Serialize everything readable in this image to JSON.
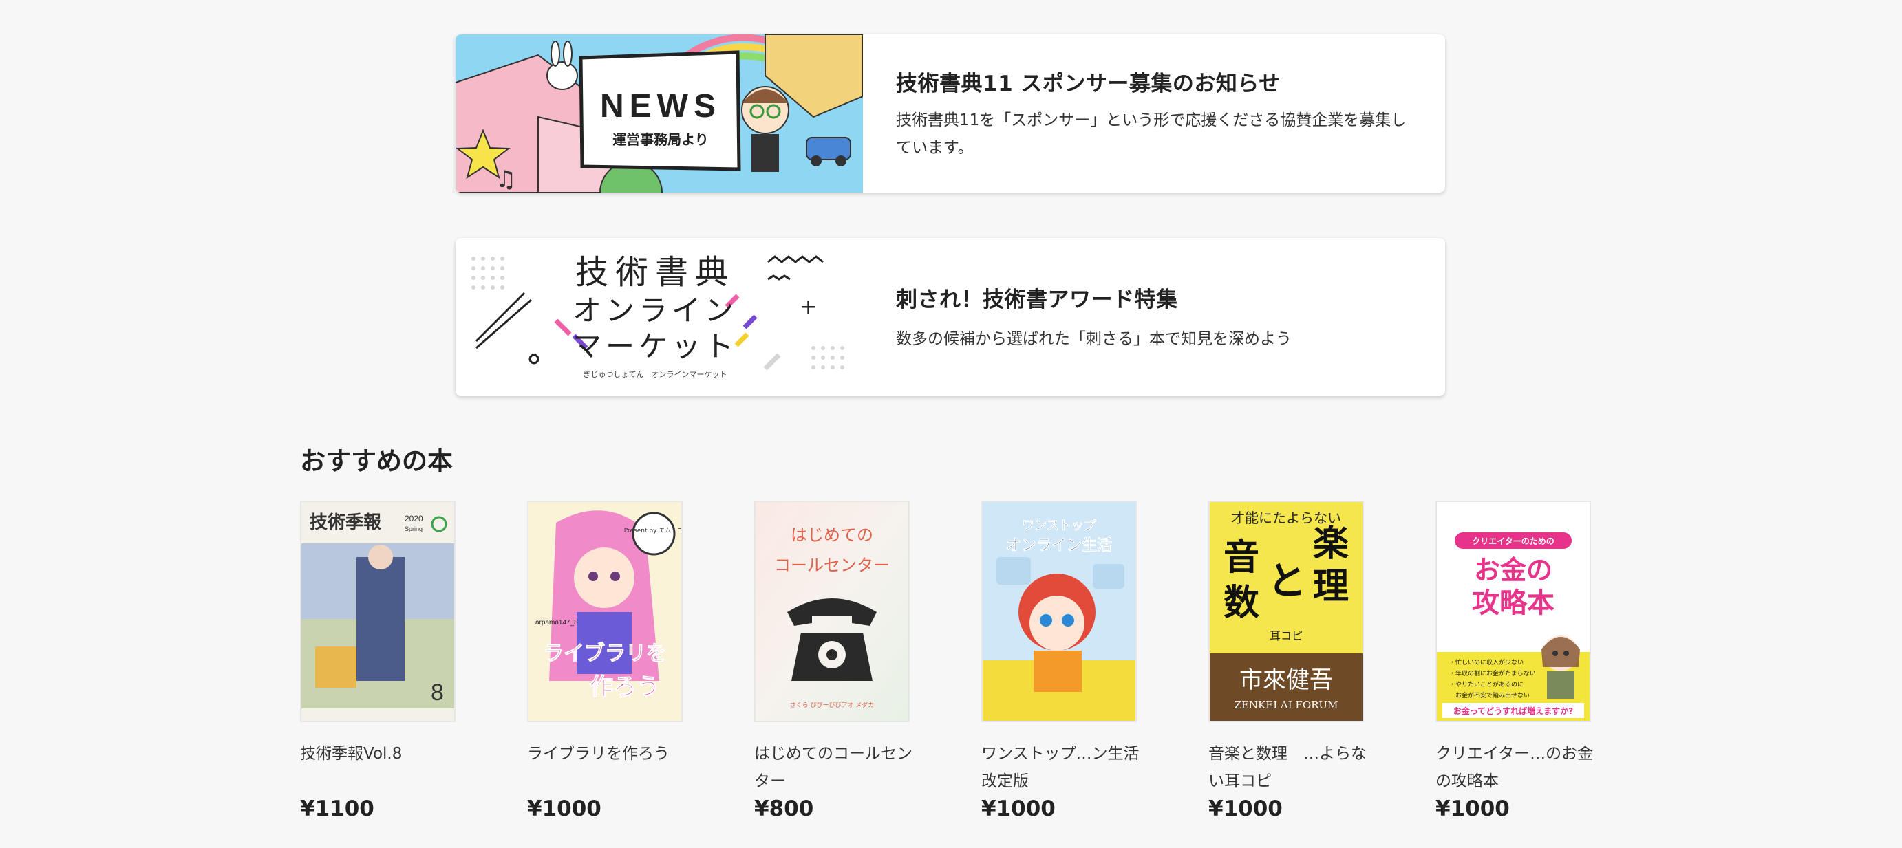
{
  "banners": [
    {
      "image": {
        "heading": "NEWS",
        "subheading": "運営事務局より"
      },
      "title": "技術書典11 スポンサー募集のお知らせ",
      "description": "技術書典11を「スポンサー」という形で応援くださる協賛企業を募集しています。"
    },
    {
      "image": {
        "line1": "技術書典",
        "line2": "オンライン",
        "line3": "マーケット",
        "caption": "ぎじゅつしょてん　オンラインマーケット"
      },
      "title": "刺され！技術書アワード特集",
      "description": "数多の候補から選ばれた「刺さる」本で知見を深めよう"
    }
  ],
  "recommended": {
    "heading": "おすすめの本",
    "books": [
      {
        "title": "技術季報Vol.8",
        "price": "¥1100",
        "cover": {
          "title": "技術季報",
          "year": "2020",
          "season": "Spring",
          "vol": "8"
        }
      },
      {
        "title": "ライブラリを作ろう",
        "price": "¥1000",
        "cover": {
          "title1": "ライブラリを",
          "title2": "作ろう",
          "badge": "Present by エムーゴ",
          "author": "arpama147_8"
        }
      },
      {
        "title": "はじめてのコールセンター",
        "price": "¥800",
        "cover": {
          "line1": "はじめての",
          "line2": "コールセンター",
          "footer": "さくら ぴぴーびびアオ メダカ"
        }
      },
      {
        "title": "ワンストップ…ン生活　改定版",
        "price": "¥1000",
        "cover": {
          "line1": "ワンストップ",
          "line2": "オンライン生活"
        }
      },
      {
        "title": "音楽と数理　…よらない耳コピ",
        "price": "¥1000",
        "cover": {
          "top": "才能にたよらない",
          "c1": "音",
          "c2": "楽",
          "c3": "と",
          "c4": "数",
          "c5": "理",
          "sub": "耳コピ",
          "author": "市來健吾",
          "forum": "ZENKEI AI FORUM"
        }
      },
      {
        "title": "クリエイター…のお金の攻略本",
        "price": "¥1000",
        "cover": {
          "tag": "クリエイターのための",
          "t1": "お金の",
          "t2": "攻略本",
          "bullet1": "・忙しいのに収入が少ない",
          "bullet2": "・年収の割にお金がたまらない",
          "bullet3": "・やりたいことがあるのに",
          "bullet4": "　お金が不安で踏み出せない",
          "question": "お金ってどうすれば増えますか?"
        }
      }
    ]
  },
  "colors": {
    "accent_pink": "#e8338a",
    "news_bg": "#8fd6f2",
    "market_pink": "#ef5fa8",
    "market_purple": "#7a4bd1",
    "market_yellow": "#f5cf2c"
  }
}
